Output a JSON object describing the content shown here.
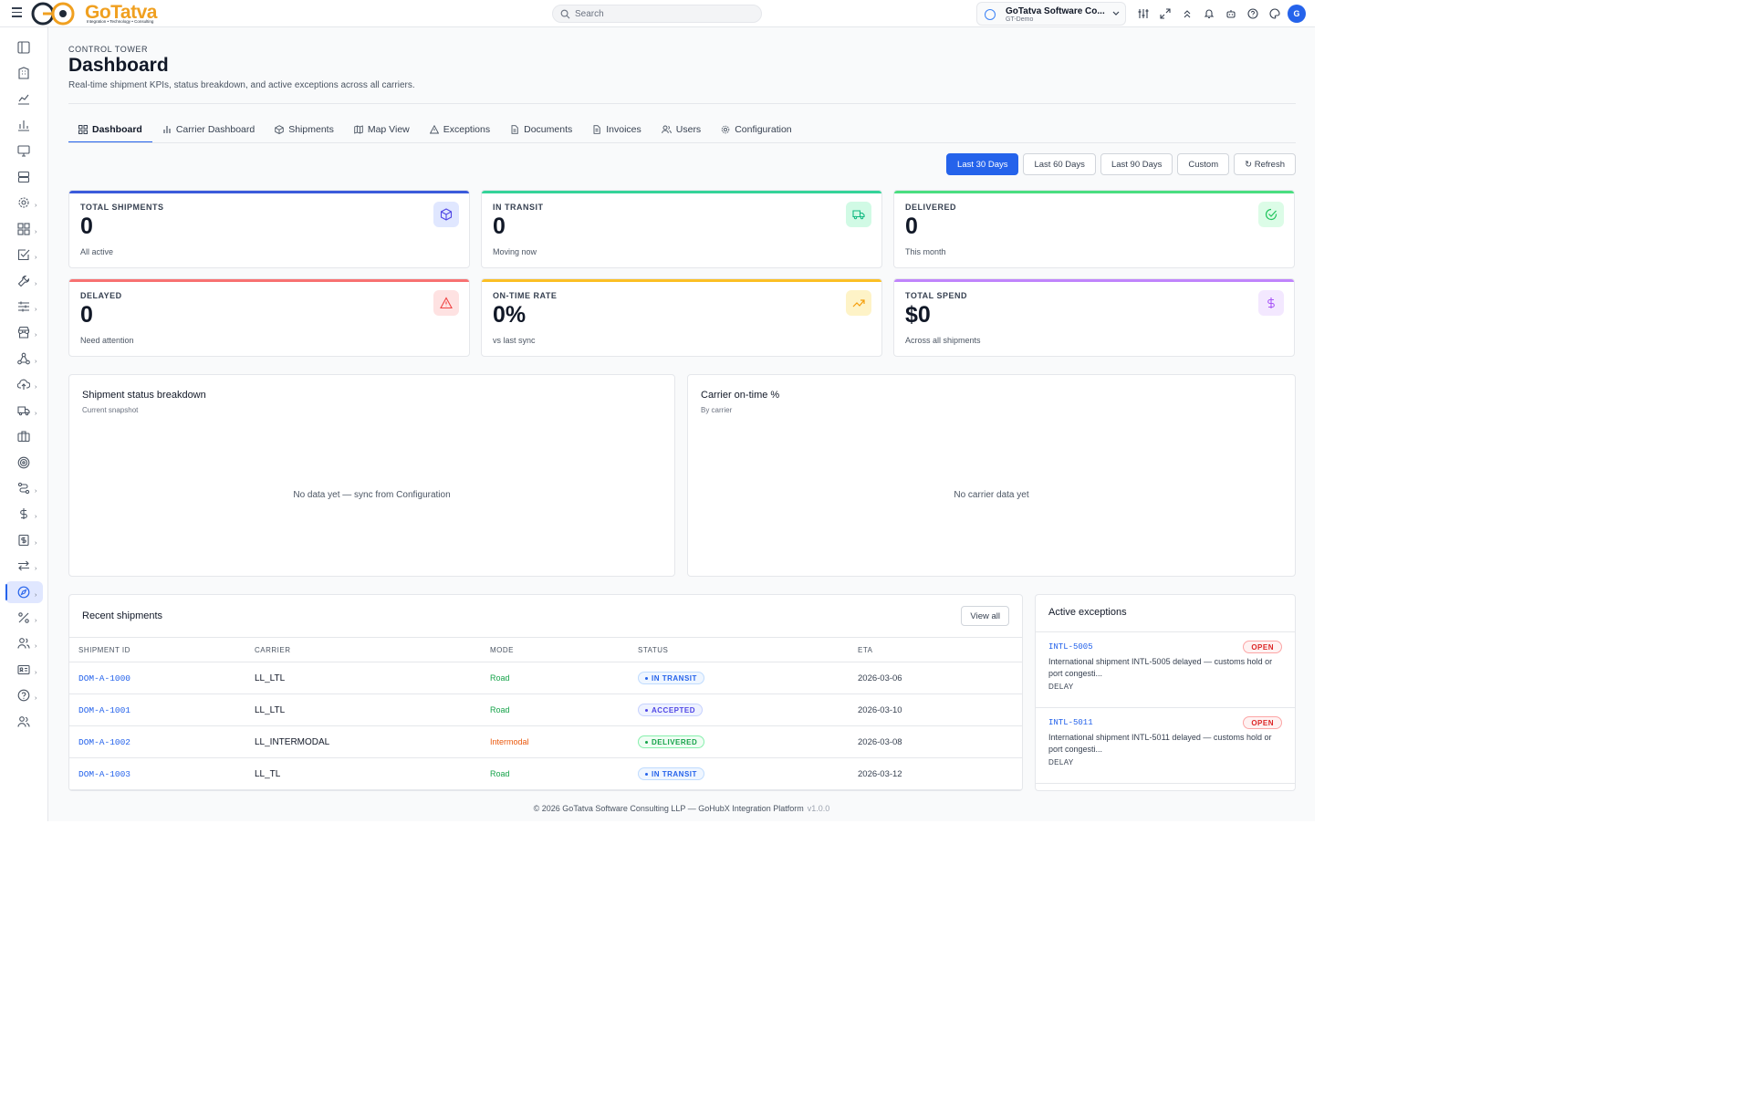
{
  "brand": {
    "name": "GoTatva",
    "tagline": "Integration • Technology • Consulting"
  },
  "search": {
    "placeholder": "Search"
  },
  "org": {
    "name": "GoTatva Software Co...",
    "sub": "GT-Demo"
  },
  "user": {
    "initial": "G"
  },
  "page": {
    "eyebrow": "CONTROL TOWER",
    "title": "Dashboard",
    "subtitle": "Real-time shipment KPIs, status breakdown, and active exceptions across all carriers."
  },
  "tabs": [
    {
      "label": "Dashboard",
      "icon": "grid-icon"
    },
    {
      "label": "Carrier Dashboard",
      "icon": "bar-chart-icon"
    },
    {
      "label": "Shipments",
      "icon": "package-icon"
    },
    {
      "label": "Map View",
      "icon": "map-icon"
    },
    {
      "label": "Exceptions",
      "icon": "warning-icon"
    },
    {
      "label": "Documents",
      "icon": "document-icon"
    },
    {
      "label": "Invoices",
      "icon": "invoice-icon"
    },
    {
      "label": "Users",
      "icon": "users-icon"
    },
    {
      "label": "Configuration",
      "icon": "gear-icon"
    }
  ],
  "ranges": [
    "Last 30 Days",
    "Last 60 Days",
    "Last 90 Days",
    "Custom",
    "↻ Refresh"
  ],
  "kpis": [
    {
      "label": "TOTAL SHIPMENTS",
      "value": "0",
      "sub": "All active",
      "color": "#3b5bdb",
      "icon": "package-icon"
    },
    {
      "label": "IN TRANSIT",
      "value": "0",
      "sub": "Moving now",
      "color": "#34d399",
      "icon": "truck-icon"
    },
    {
      "label": "DELIVERED",
      "value": "0",
      "sub": "This month",
      "color": "#4ade80",
      "icon": "check-circle-icon"
    },
    {
      "label": "DELAYED",
      "value": "0",
      "sub": "Need attention",
      "color": "#f87171",
      "icon": "warning-icon"
    },
    {
      "label": "ON-TIME RATE",
      "value": "0%",
      "sub": "vs last sync",
      "color": "#fbbf24",
      "icon": "trending-up-icon"
    },
    {
      "label": "TOTAL SPEND",
      "value": "$0",
      "sub": "Across all shipments",
      "color": "#c084fc",
      "icon": "dollar-icon"
    }
  ],
  "status_panel": {
    "title": "Shipment status breakdown",
    "sub": "Current snapshot",
    "empty": "No data yet — sync from Configuration"
  },
  "carrier_panel": {
    "title": "Carrier on-time %",
    "sub": "By carrier",
    "empty": "No carrier data yet"
  },
  "recent": {
    "title": "Recent shipments",
    "view_all": "View all",
    "columns": [
      "SHIPMENT ID",
      "CARRIER",
      "MODE",
      "STATUS",
      "ETA"
    ],
    "rows": [
      {
        "id": "DOM-A-1000",
        "carrier": "LL_LTL",
        "mode": "Road",
        "status": "IN TRANSIT",
        "eta": "2026-03-06"
      },
      {
        "id": "DOM-A-1001",
        "carrier": "LL_LTL",
        "mode": "Road",
        "status": "ACCEPTED",
        "eta": "2026-03-10"
      },
      {
        "id": "DOM-A-1002",
        "carrier": "LL_INTERMODAL",
        "mode": "Intermodal",
        "status": "DELIVERED",
        "eta": "2026-03-08"
      },
      {
        "id": "DOM-A-1003",
        "carrier": "LL_TL",
        "mode": "Road",
        "status": "IN TRANSIT",
        "eta": "2026-03-12"
      }
    ]
  },
  "exceptions": {
    "title": "Active exceptions",
    "items": [
      {
        "id": "INTL-5005",
        "badge": "OPEN",
        "desc": "International shipment INTL-5005 delayed — customs hold or port congesti...",
        "type": "DELAY"
      },
      {
        "id": "INTL-5011",
        "badge": "OPEN",
        "desc": "International shipment INTL-5011 delayed — customs hold or port congesti...",
        "type": "DELAY"
      }
    ]
  },
  "footer": {
    "text": "© 2026 GoTatva Software Consulting LLP — GoHubX Integration Platform",
    "version": "v1.0.0"
  },
  "sidebar_icons": [
    "layout-icon",
    "building-icon",
    "line-chart-icon",
    "bar-chart-icon",
    "monitor-icon",
    "server-icon",
    "gear-icon",
    "apps-icon",
    "checkbox-icon",
    "wrench-icon",
    "sliders-icon",
    "store-icon",
    "network-icon",
    "cloud-upload-icon",
    "truck-icon",
    "briefcase-icon",
    "target-icon",
    "route-icon",
    "dollar-icon",
    "receipt-icon",
    "arrows-icon",
    "compass-icon",
    "percent-icon",
    "users-icon",
    "id-card-icon",
    "help-icon",
    "team-icon"
  ]
}
